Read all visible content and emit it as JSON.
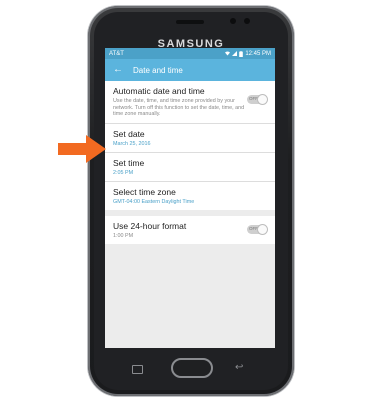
{
  "device": {
    "brand": "SAMSUNG"
  },
  "status_bar": {
    "carrier": "AT&T",
    "time": "12:45 PM"
  },
  "app_bar": {
    "title": "Date and time"
  },
  "settings": {
    "automatic": {
      "title": "Automatic date and time",
      "description": "Use the date, time, and time zone provided by your network. Turn off this function to set the date, time, and time zone manually.",
      "toggle": "OFF"
    },
    "set_date": {
      "title": "Set date",
      "value": "March 25, 2016"
    },
    "set_time": {
      "title": "Set time",
      "value": "2:05 PM"
    },
    "time_zone": {
      "title": "Select time zone",
      "value": "GMT-04:00 Eastern Daylight Time"
    },
    "format_24h": {
      "title": "Use 24-hour format",
      "value": "1:00 PM",
      "toggle": "OFF"
    }
  },
  "colors": {
    "accent": "#5bb4dd",
    "arrow": "#f26a21"
  }
}
